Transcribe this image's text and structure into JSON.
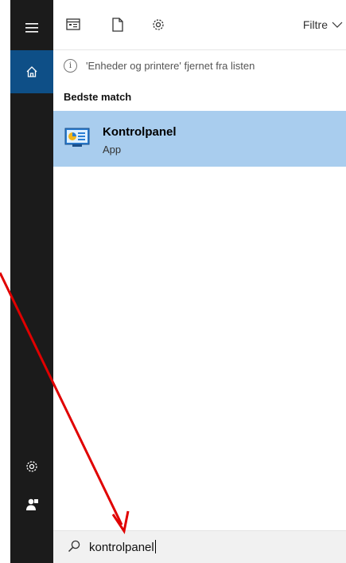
{
  "toolbar": {
    "icons": [
      "apps-icon",
      "document-icon",
      "settings-icon"
    ],
    "filter_label": "Filtre"
  },
  "sidebar": {
    "items": [
      "menu-icon",
      "home-icon",
      "settings-icon",
      "user-icon"
    ]
  },
  "notice": {
    "text": "'Enheder og printere' fjernet fra listen"
  },
  "results": {
    "section_title": "Bedste match",
    "items": [
      {
        "name": "Kontrolpanel",
        "type": "App",
        "icon": "control-panel-icon"
      }
    ]
  },
  "search": {
    "value": "kontrolpanel"
  },
  "annotation": {
    "color": "#e00000",
    "icon": "red-arrow-annotation"
  },
  "colors": {
    "rail_bg": "#1b1b1b",
    "home_active": "#0e4f87",
    "selected_result": "#a9cdee"
  }
}
